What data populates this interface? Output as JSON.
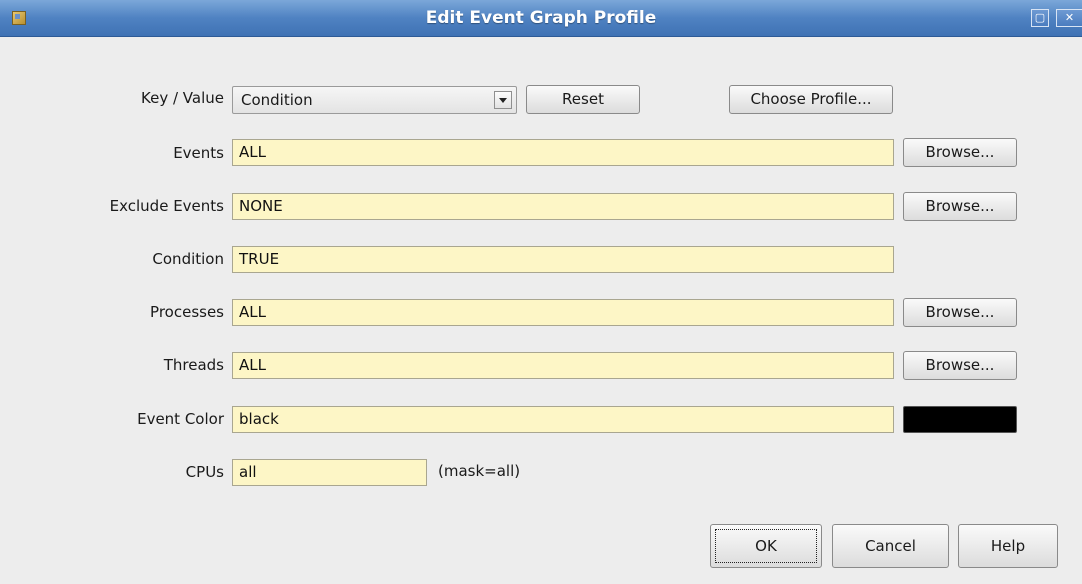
{
  "window": {
    "title": "Edit Event Graph Profile",
    "buttons": [
      "maximize-icon",
      "close-icon"
    ]
  },
  "form": {
    "key_value": {
      "label": "Key / Value",
      "selected": "Condition"
    },
    "reset_label": "Reset",
    "choose_profile_label": "Choose Profile...",
    "events": {
      "label": "Events",
      "value": "ALL",
      "browse": "Browse..."
    },
    "exclude_events": {
      "label": "Exclude Events",
      "value": "NONE",
      "browse": "Browse..."
    },
    "condition": {
      "label": "Condition",
      "value": "TRUE"
    },
    "processes": {
      "label": "Processes",
      "value": "ALL",
      "browse": "Browse..."
    },
    "threads": {
      "label": "Threads",
      "value": "ALL",
      "browse": "Browse..."
    },
    "event_color": {
      "label": "Event Color",
      "value": "black",
      "swatch": "#000000"
    },
    "cpus": {
      "label": "CPUs",
      "value": "all",
      "mask_text": "(mask=all)"
    }
  },
  "footer": {
    "ok_label": "OK",
    "cancel_label": "Cancel",
    "help_label": "Help"
  },
  "colors": {
    "title_bar": "#4f82c2",
    "field_background": "#fdf6c6",
    "dialog_background": "#ededed"
  }
}
